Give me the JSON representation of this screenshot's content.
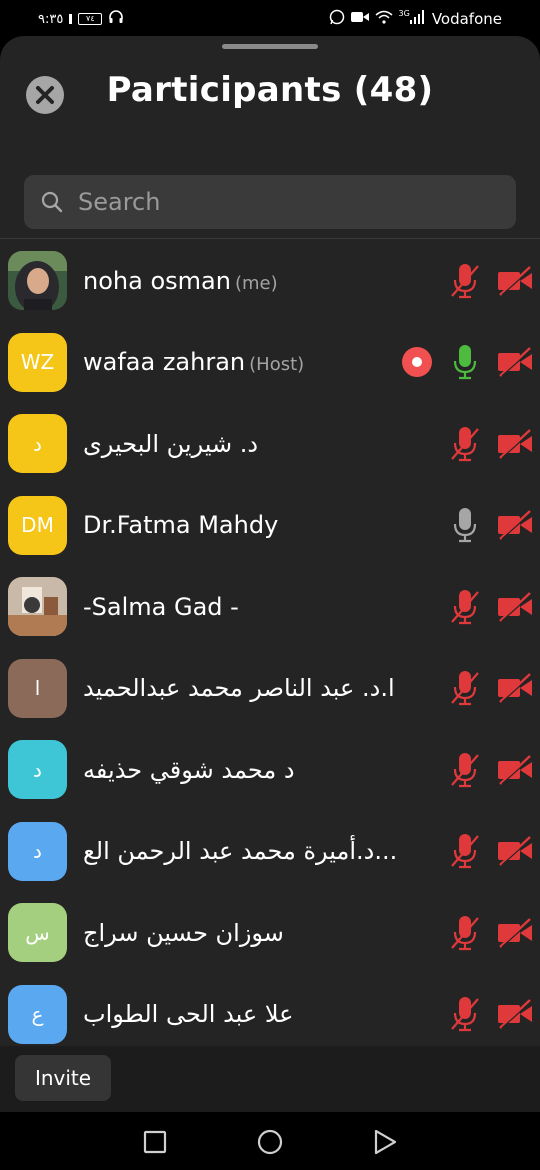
{
  "status_bar": {
    "time": "٩:٣٥",
    "battery": "٧٤",
    "carrier": "Vodafone",
    "network": "3G",
    "icons": [
      "sim-icon",
      "battery-icon",
      "headset-icon",
      "whatsapp-icon",
      "video-icon",
      "wifi-icon",
      "signal-icon"
    ]
  },
  "sheet": {
    "title": "Participants (48)",
    "close_icon": "close-icon"
  },
  "search": {
    "placeholder": "Search",
    "value": "",
    "icon": "search-icon"
  },
  "participants": [
    {
      "name": "noha osman",
      "tag": "(me)",
      "avatar": {
        "type": "photo"
      },
      "mic": "muted",
      "video": "off",
      "recording": false
    },
    {
      "name": "wafaa zahran",
      "tag": "(Host)",
      "avatar": {
        "type": "initials",
        "text": "WZ",
        "color": "#f5c518"
      },
      "mic": "active",
      "video": "off",
      "recording": true
    },
    {
      "name": "د. شيرين البحيرى",
      "tag": "",
      "avatar": {
        "type": "initials",
        "text": "د",
        "color": "#f5c518"
      },
      "mic": "muted",
      "video": "off",
      "recording": false
    },
    {
      "name": "Dr.Fatma Mahdy",
      "tag": "",
      "avatar": {
        "type": "initials",
        "text": "DM",
        "color": "#f5c518"
      },
      "mic": "unmuted",
      "video": "off",
      "recording": false
    },
    {
      "name": "-Salma Gad -",
      "tag": "",
      "avatar": {
        "type": "photo"
      },
      "mic": "muted",
      "video": "off",
      "recording": false
    },
    {
      "name": "ا.د. عبد الناصر محمد عبدالحميد",
      "tag": "",
      "avatar": {
        "type": "initials",
        "text": "ا",
        "color": "#8c6a5a"
      },
      "mic": "muted",
      "video": "off",
      "recording": false
    },
    {
      "name": "د محمد شوقي حذيفه",
      "tag": "",
      "avatar": {
        "type": "initials",
        "text": "د",
        "color": "#3fc6d6"
      },
      "mic": "muted",
      "video": "off",
      "recording": false
    },
    {
      "name": "د.أميرة محمد عبد الرحمن الع...",
      "tag": "",
      "avatar": {
        "type": "initials",
        "text": "د",
        "color": "#5aa8f0"
      },
      "mic": "muted",
      "video": "off",
      "recording": false
    },
    {
      "name": "سوزان حسين سراج",
      "tag": "",
      "avatar": {
        "type": "initials",
        "text": "س",
        "color": "#a4cf7e"
      },
      "mic": "muted",
      "video": "off",
      "recording": false
    },
    {
      "name": "علا عبد الحى الطواب",
      "tag": "",
      "avatar": {
        "type": "initials",
        "text": "ع",
        "color": "#5aa8f0"
      },
      "mic": "muted",
      "video": "off",
      "recording": false
    }
  ],
  "footer": {
    "invite_label": "Invite"
  },
  "navbar": {
    "buttons": [
      "recents-square-icon",
      "home-circle-icon",
      "back-triangle-icon"
    ]
  },
  "colors": {
    "sheet_bg": "#242424",
    "muted_red": "#e0393b",
    "active_green": "#4cbb3e",
    "unmuted_gray": "#a6a6a6",
    "record_red": "#f0504f"
  }
}
